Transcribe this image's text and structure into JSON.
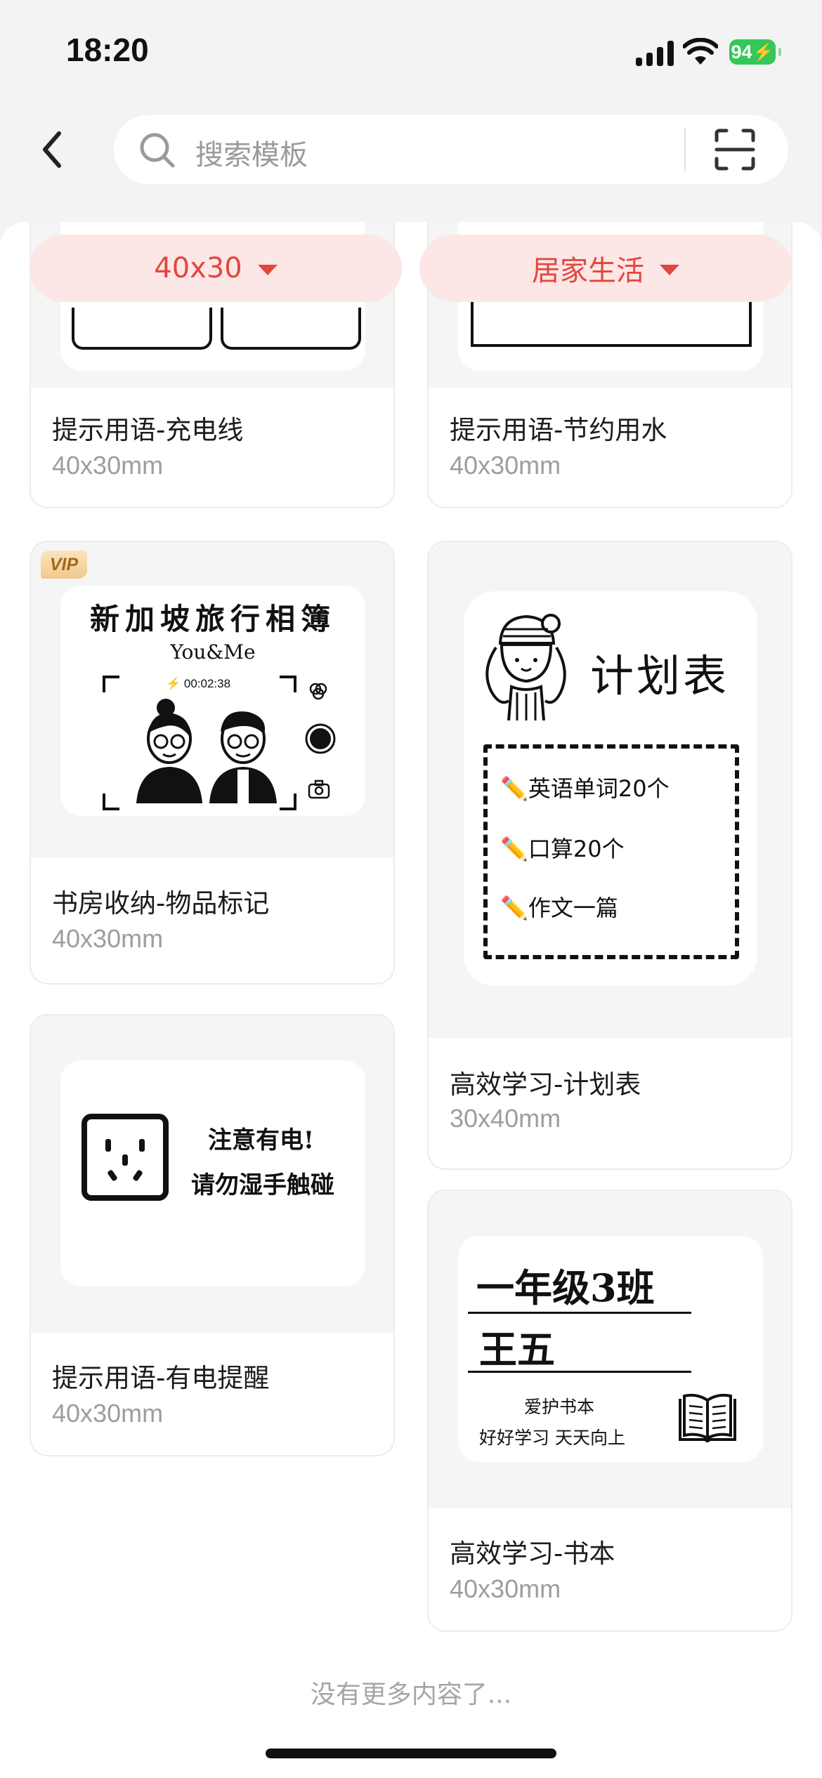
{
  "status_bar": {
    "time": "18:20",
    "battery": "94"
  },
  "search": {
    "placeholder": "搜索模板"
  },
  "filters": {
    "size": "40x30",
    "category": "居家生活"
  },
  "cards": [
    {
      "title": "提示用语-充电线",
      "size": "40x30mm"
    },
    {
      "title": "提示用语-节约用水",
      "size": "40x30mm"
    },
    {
      "title": "书房收纳-物品标记",
      "size": "40x30mm",
      "badge": "VIP",
      "preview": {
        "heading": "新加坡旅行相簿",
        "sub": "You&Me",
        "timer": "00:02:38"
      }
    },
    {
      "title": "高效学习-计划表",
      "size": "30x40mm",
      "preview": {
        "heading": "计划表",
        "items": [
          "✏️英语单词20个",
          "✏️口算20个",
          "✏️作文一篇"
        ]
      }
    },
    {
      "title": "提示用语-有电提醒",
      "size": "40x30mm",
      "preview": {
        "line1": "注意有电!",
        "line2": "请勿湿手触碰"
      }
    },
    {
      "title": "高效学习-书本",
      "size": "40x30mm",
      "preview": {
        "line1": "一年级3班",
        "line2": "王五",
        "line3": "爱护书本",
        "line4": "好好学习 天天向上"
      }
    }
  ],
  "footer": {
    "end_text": "没有更多内容了..."
  },
  "colors": {
    "accent": "#e2463f",
    "filter_bg": "#fde6e6",
    "battery": "#34c759"
  },
  "icons": [
    "back-arrow-icon",
    "search-icon",
    "scan-icon",
    "cellular-signal-icon",
    "wifi-icon",
    "battery-icon",
    "caret-down-icon",
    "book-icon",
    "socket-icon"
  ]
}
